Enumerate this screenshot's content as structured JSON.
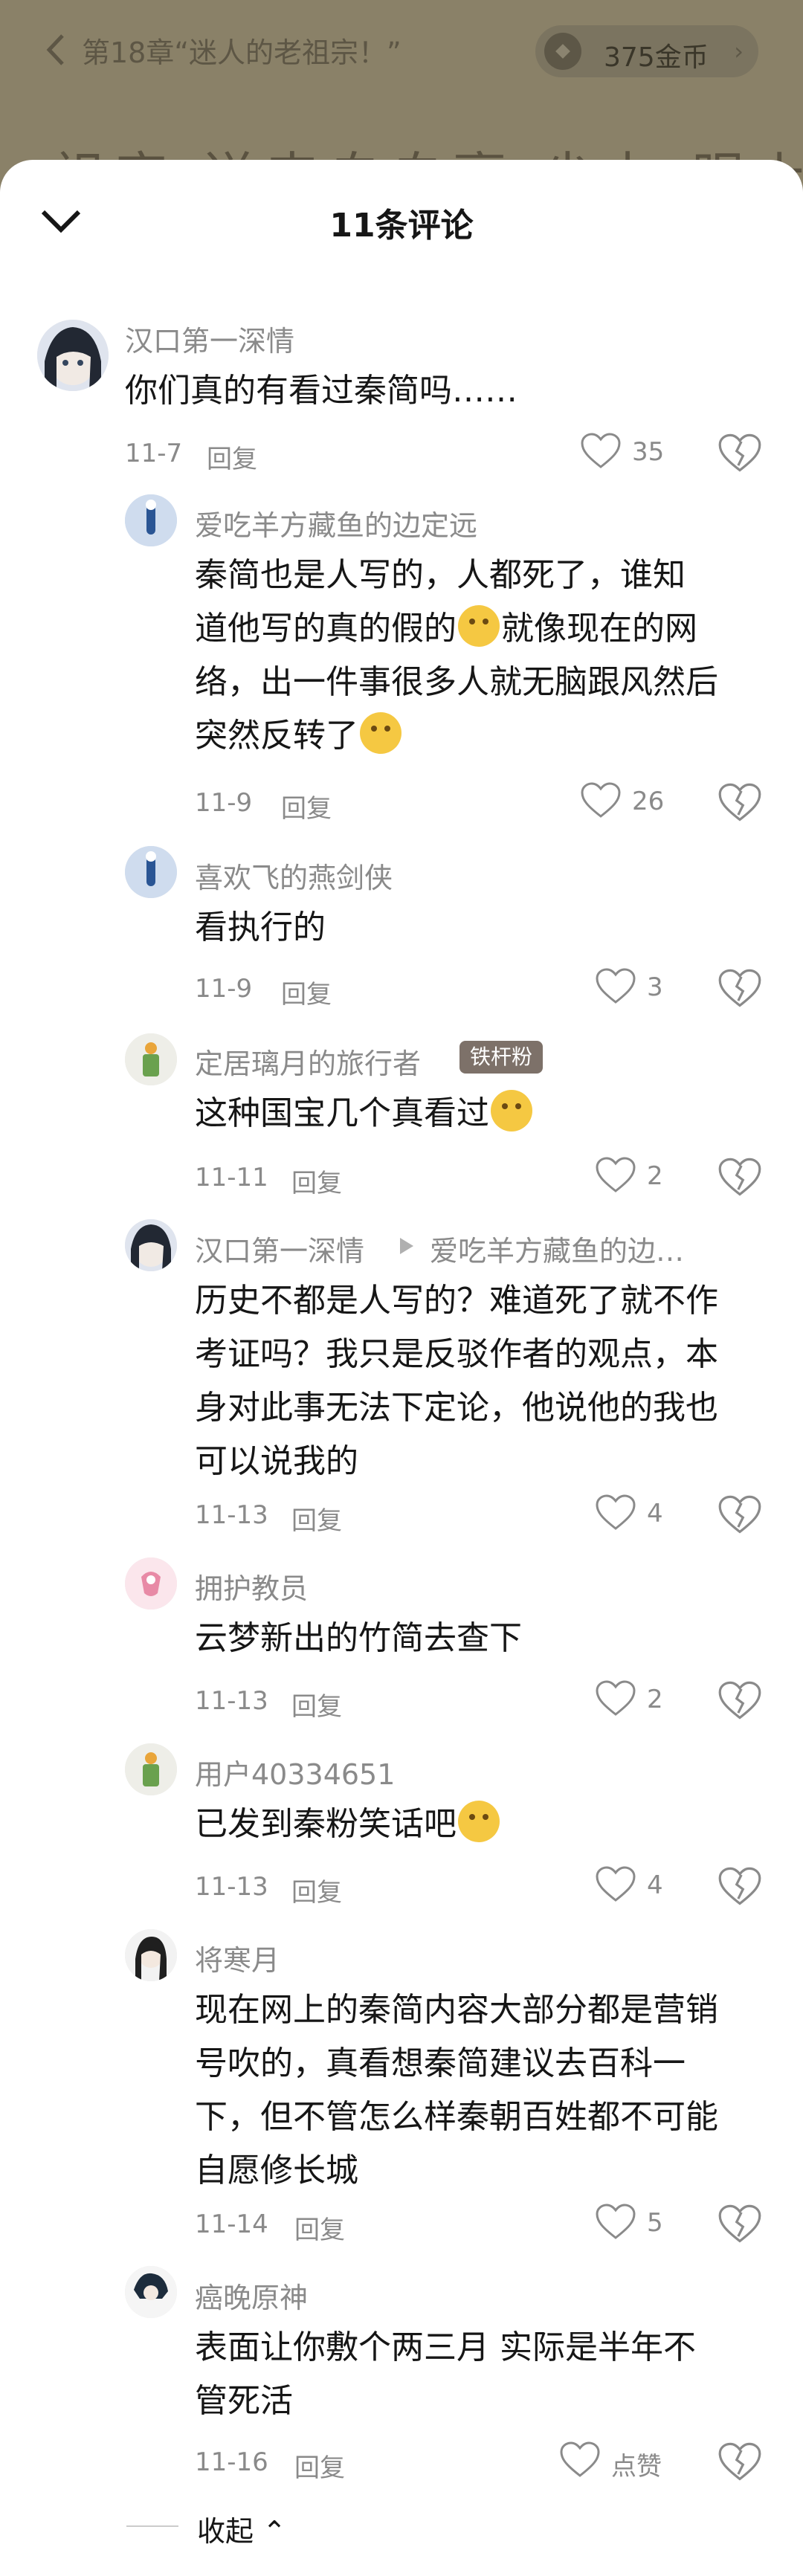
{
  "reader": {
    "chapter_title": "第18章“迷人的老祖宗！”",
    "coins_label": "375金币",
    "background_text": "祖宗 送来自自豪 尖力 眼上"
  },
  "panel": {
    "title": "11条评论",
    "collapse_label": "收起"
  },
  "reply_label": "回复",
  "comments": [
    {
      "user": "汉口第一深情",
      "text": "你们真的有看过秦简吗……",
      "date": "11-7",
      "likes": "35"
    },
    {
      "user": "爱吃羊方藏鱼的边定远",
      "text_1": "秦简也是人写的，人都死了，谁知",
      "text_2": "道他写的真的假的",
      "text_3": "就像现在的网",
      "text_4": "络，出一件事很多人就无脑跟风然后",
      "text_5": "突然反转了",
      "date": "11-9",
      "likes": "26"
    },
    {
      "user": "喜欢飞的燕剑侠",
      "text": "看执行的",
      "date": "11-9",
      "likes": "3"
    },
    {
      "user": "定居璃月的旅行者",
      "badge": "铁杆粉",
      "text": "这种国宝几个真看过",
      "date": "11-11",
      "likes": "2"
    },
    {
      "user": "汉口第一深情",
      "reply_to": "爱吃羊方藏鱼的边…",
      "text_1": "历史不都是人写的？难道死了就不作",
      "text_2": "考证吗？我只是反驳作者的观点，本",
      "text_3": "身对此事无法下定论，他说他的我也",
      "text_4": "可以说我的",
      "date": "11-13",
      "likes": "4"
    },
    {
      "user": "拥护教员",
      "text": "云梦新出的竹简去查下",
      "date": "11-13",
      "likes": "2"
    },
    {
      "user": "用户40334651",
      "text": "已发到秦粉笑话吧",
      "date": "11-13",
      "likes": "4"
    },
    {
      "user": "将寒月",
      "text_1": "现在网上的秦简内容大部分都是营销",
      "text_2": "号吹的，真看想秦简建议去百科一",
      "text_3": "下，但不管怎么样秦朝百姓都不可能",
      "text_4": "自愿修长城",
      "date": "11-14",
      "likes": "5"
    },
    {
      "user": "癌晚原神",
      "text_1": "表面让你敷个两三月 实际是半年不",
      "text_2": "管死活",
      "date": "11-16",
      "likes": "点赞"
    }
  ]
}
